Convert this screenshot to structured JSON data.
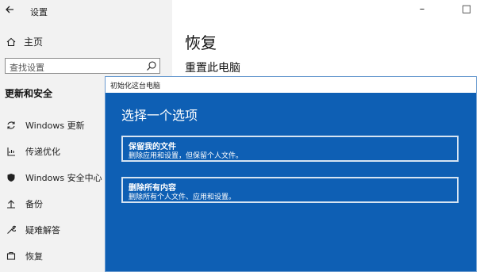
{
  "window": {
    "title": "设置",
    "back_icon": "back-arrow-icon",
    "minimize": "–",
    "maximize": "□"
  },
  "sidebar": {
    "home_label": "主页",
    "search_placeholder": "查找设置",
    "section_title": "更新和安全",
    "items": [
      {
        "label": "Windows 更新",
        "icon": "sync-icon"
      },
      {
        "label": "传递优化",
        "icon": "delivery-optimization-icon"
      },
      {
        "label": "Windows 安全中心",
        "icon": "shield-icon"
      },
      {
        "label": "备份",
        "icon": "backup-icon"
      },
      {
        "label": "疑难解答",
        "icon": "wrench-icon"
      },
      {
        "label": "恢复",
        "icon": "recovery-icon"
      }
    ]
  },
  "main": {
    "title": "恢复",
    "subtitle": "重置此电脑"
  },
  "dialog": {
    "title": "初始化这台电脑",
    "heading": "选择一个选项",
    "options": [
      {
        "title": "保留我的文件",
        "desc": "删除应用和设置，但保留个人文件。"
      },
      {
        "title": "删除所有内容",
        "desc": "删除所有个人文件、应用和设置。"
      }
    ],
    "colors": {
      "background": "#0e5fb4",
      "option_border": "#d6e4f2"
    }
  }
}
